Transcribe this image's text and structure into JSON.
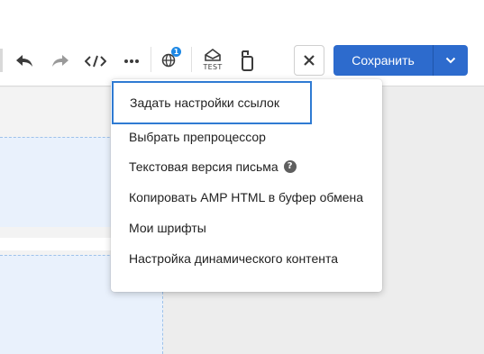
{
  "toolbar": {
    "notification_count": "1",
    "test_label": "TEST",
    "save_label": "Сохранить"
  },
  "menu": {
    "items": [
      {
        "label": "Задать настройки ссылок"
      },
      {
        "label": "Выбрать препроцессор"
      },
      {
        "label": "Текстовая версия письма",
        "help": "?"
      },
      {
        "label": "Копировать AMP HTML в буфер обмена"
      },
      {
        "label": "Мои шрифты"
      },
      {
        "label": "Настройка динамического контента"
      }
    ]
  },
  "colors": {
    "accent": "#2d6bcd",
    "focus_outline": "#2f7bd3",
    "badge": "#1e88e5"
  },
  "icons": [
    "undo-icon",
    "redo-icon",
    "code-icon",
    "more-icon",
    "globe-icon",
    "test-icon",
    "mobile-preview-icon",
    "close-icon",
    "chevron-down-icon",
    "help-icon"
  ]
}
